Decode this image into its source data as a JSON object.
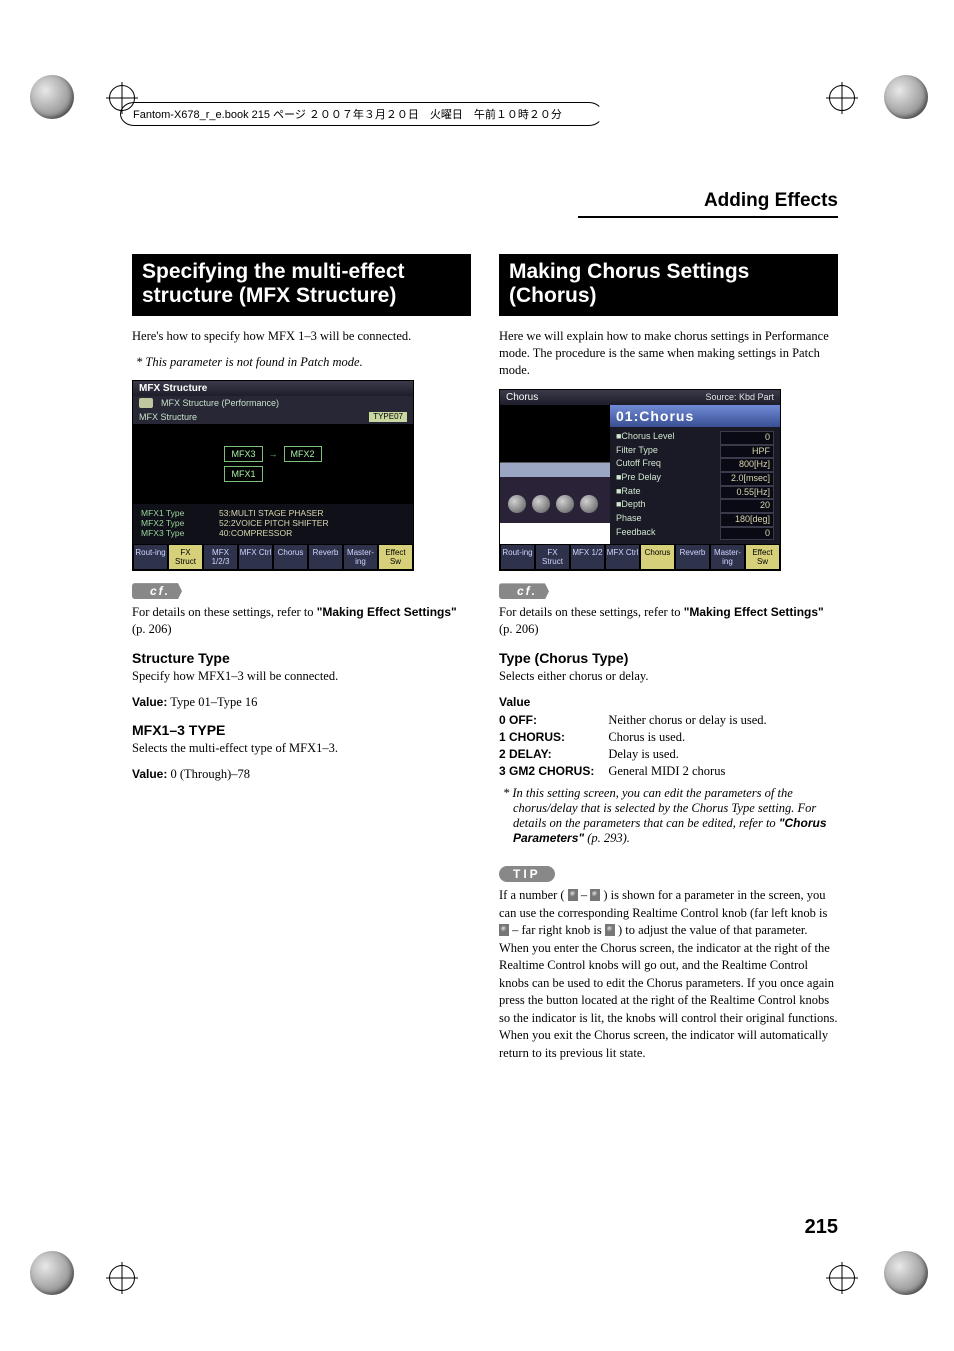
{
  "page": {
    "header_filename": "Fantom-X678_r_e.book  215 ページ  ２００７年３月２０日　火曜日　午前１０時２０分",
    "section_title": "Adding Effects",
    "page_number": "215"
  },
  "left": {
    "heading": "Specifying the multi-effect structure (MFX Structure)",
    "intro": "Here's how to specify how MFX 1–3 will be connected.",
    "note": "This parameter is not found in Patch mode.",
    "screenshot": {
      "title": "MFX Structure",
      "subtitle_left": "MFX Structure (Performance)",
      "subtitle_right": "MFX Structure",
      "badge": "TYPE07",
      "nodes": {
        "a": "MFX3",
        "b": "MFX2",
        "c": "MFX1"
      },
      "table": [
        {
          "label": "MFX1 Type",
          "value": "53:MULTI STAGE PHASER"
        },
        {
          "label": "MFX2 Type",
          "value": "52:2VOICE PITCH SHIFTER"
        },
        {
          "label": "MFX3 Type",
          "value": "40:COMPRESSOR"
        }
      ],
      "softkeys": [
        "Rout-ing",
        "FX Struct",
        "MFX 1/2/3",
        "MFX Ctrl",
        "Chorus",
        "Reverb",
        "Master-ing",
        "Effect Sw"
      ]
    },
    "cf_label": "cf.",
    "cf_text_a": "For details on these settings, refer to ",
    "cf_text_bold": "\"Making Effect Settings\"",
    "cf_text_b": " (p. 206)",
    "h_structure": "Structure Type",
    "structure_desc": "Specify how MFX1–3 will be connected.",
    "structure_value_label": "Value:",
    "structure_value": "Type 01–Type 16",
    "h_mfxtype": "MFX1–3 TYPE",
    "mfxtype_desc": "Selects the multi-effect type of MFX1–3.",
    "mfxtype_value_label": "Value:",
    "mfxtype_value": "0 (Through)–78"
  },
  "right": {
    "heading": "Making Chorus Settings (Chorus)",
    "intro": "Here we will explain how to make chorus settings in Performance mode. The procedure is the same when making settings in Patch mode.",
    "screenshot": {
      "title_left": "Chorus",
      "title_right": "Source: Kbd Part",
      "panel": "01:Chorus",
      "params": [
        {
          "name": "■Chorus Level",
          "value": "0"
        },
        {
          "name": "Filter Type",
          "value": "HPF"
        },
        {
          "name": "Cutoff Freq",
          "value": "800[Hz]"
        },
        {
          "name": "■Pre Delay",
          "value": "2.0[msec]"
        },
        {
          "name": "■Rate",
          "value": "0.55[Hz]"
        },
        {
          "name": "■Depth",
          "value": "20"
        },
        {
          "name": "Phase",
          "value": "180[deg]"
        },
        {
          "name": "Feedback",
          "value": "0"
        }
      ],
      "softkeys": [
        "Rout-ing",
        "FX Struct",
        "MFX 1/2",
        "MFX Ctrl",
        "Chorus",
        "Reverb",
        "Master-ing",
        "Effect Sw"
      ]
    },
    "cf_label": "cf.",
    "cf_text_a": "For details on these settings, refer to ",
    "cf_text_bold": "\"Making Effect Settings\"",
    "cf_text_b": " (p. 206)",
    "h_type": "Type (Chorus Type)",
    "type_desc": "Selects either chorus or delay.",
    "value_header": "Value",
    "rows": [
      {
        "k": "0 OFF:",
        "v": "Neither chorus or delay is used."
      },
      {
        "k": "1 CHORUS:",
        "v": "Chorus is used."
      },
      {
        "k": "2 DELAY:",
        "v": "Delay is used."
      },
      {
        "k": "3 GM2 CHORUS:",
        "v": "General MIDI 2 chorus"
      }
    ],
    "note2_a": "In this setting screen, you can edit the parameters of the chorus/delay that is selected by the Chorus Type setting. For details on the parameters that can be edited, refer to ",
    "note2_bold": "\"Chorus Parameters\"",
    "note2_b": " (p. 293).",
    "tip_label": "TIP",
    "tip_body_a": "If a number ( ",
    "tip_body_b": " – ",
    "tip_body_c": " ) is shown for a parameter in the screen, you can use the corresponding Realtime Control knob (far left knob is ",
    "tip_body_d": " – far right knob is ",
    "tip_body_e": " ) to adjust the value of that parameter. When you enter the Chorus screen, the indicator at the right of the Realtime Control knobs will go out, and the Realtime Control knobs can be used to edit the Chorus parameters. If you once again press the button located at the right of the Realtime Control knobs so the indicator is lit, the knobs will control their original functions. When you exit the Chorus screen, the indicator will automatically return to its previous lit state."
  }
}
